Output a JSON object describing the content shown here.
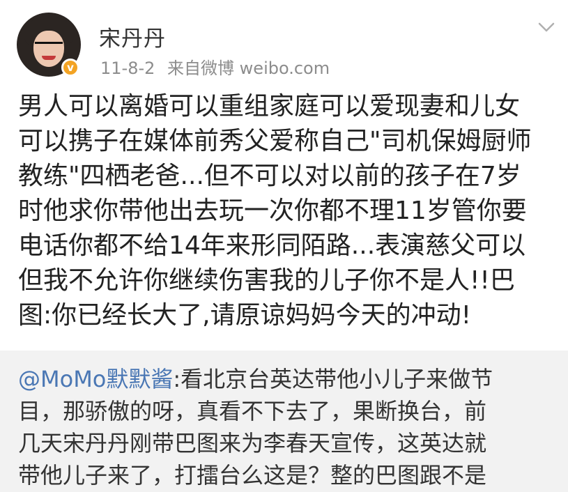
{
  "author": {
    "name": "宋丹丹",
    "date": "11-8-2",
    "source": "来自微博 weibo.com",
    "verified": true,
    "badge_color": "#f3a323"
  },
  "post": {
    "lines": [
      "男人可以离婚可以重组家庭可以爱现妻和儿女",
      "可以携子在媒体前秀父爱称自己\"司机保姆厨师",
      "教练\"四栖老爸...但不可以对以前的孩子在7岁",
      "时他求你带他出去玩一次你都不理11岁管你要",
      "电话你都不给14年来形同陌路...表演慈父可以",
      "但我不允许你继续伤害我的儿子你不是人!!巴",
      "图:你已经长大了,请原谅妈妈今天的冲动!"
    ]
  },
  "repost": {
    "mention": "@MoMo默默酱",
    "first_line_rest": ":看北京台英达带他小儿子来做节",
    "lines": [
      "目，那骄傲的呀，真看不下去了，果断换台，前",
      "几天宋丹丹刚带巴图来为李春天宣传，这英达就",
      "带他儿子来了，打擂台么这是？整的巴图跟不是"
    ]
  },
  "icons": {
    "menu": "chevron-down-icon",
    "verified": "verified-badge-icon"
  },
  "colors": {
    "mention": "#4a77b4",
    "repost_background": "#f2f2f2",
    "meta_text": "#8c8c8c"
  }
}
